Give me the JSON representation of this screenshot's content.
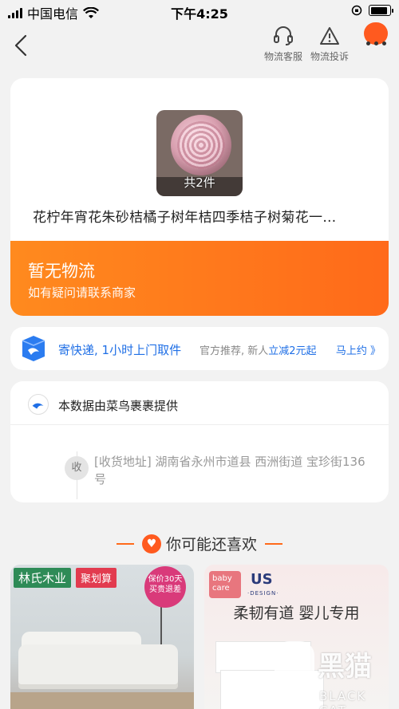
{
  "status_bar": {
    "carrier": "中国电信",
    "time": "下午4:25",
    "battery_level": 0.9
  },
  "nav": {
    "customer_service": "物流客服",
    "complaint": "物流投诉"
  },
  "product": {
    "item_count": "共2件",
    "title": "花柠年宵花朱砂桔橘子树年桔四季桔子树菊花一…"
  },
  "logistics": {
    "status": "暂无物流",
    "hint": "如有疑问请联系商家"
  },
  "express": {
    "main_text": "寄快递, 1小时上门取件",
    "sub_prefix": "官方推荐, 新人",
    "sub_highlight": "立减2元起",
    "link": "马上约 》"
  },
  "data_source": {
    "text": "本数据由菜鸟裹裹提供",
    "receive_tag": "收",
    "address": "[收货地址] 湖南省永州市道县  西洲街道   宝珍街136号"
  },
  "recommend": {
    "title": "你可能还喜欢",
    "left": {
      "brand": "林氏木业",
      "tag": "聚划算",
      "promo": "保价30天 买贵退差"
    },
    "right": {
      "brand_a": "baby care",
      "brand_b": "US",
      "brand_b_sub": "·DESIGN·",
      "slogan": "柔韧有道  婴儿专用"
    }
  },
  "watermark": {
    "cn": "黑猫",
    "en": "BLACK CAT"
  },
  "colors": {
    "accent": "#ff6a1a",
    "link": "#1f6fe6"
  }
}
